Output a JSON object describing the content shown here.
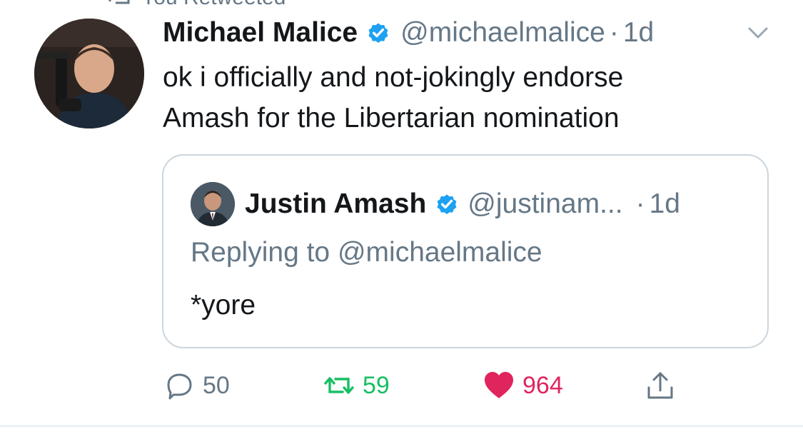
{
  "context": {
    "label": "You Retweeted",
    "icon": "retweet-icon"
  },
  "tweet": {
    "author_name": "Michael Malice",
    "handle": "@michaelmalice",
    "separator": "·",
    "time": "1d",
    "verified": true,
    "text_line1": "ok i officially and not-jokingly endorse",
    "text_line2": "Amash for the Libertarian nomination"
  },
  "quote": {
    "author_name": "Justin Amash",
    "handle": "@justinam...",
    "separator": "·",
    "time": "1d",
    "verified": true,
    "reply_prefix": "Replying to ",
    "reply_handle": "@michaelmalice",
    "text": "*yore"
  },
  "actions": {
    "reply_count": "50",
    "retweet_count": "59",
    "like_count": "964",
    "liked": true,
    "retweeted": false
  },
  "colors": {
    "verified": "#1da1f2",
    "secondary_text": "#657786",
    "retweet": "#17bf63",
    "like": "#e0245e",
    "border": "#ccd6dd"
  }
}
